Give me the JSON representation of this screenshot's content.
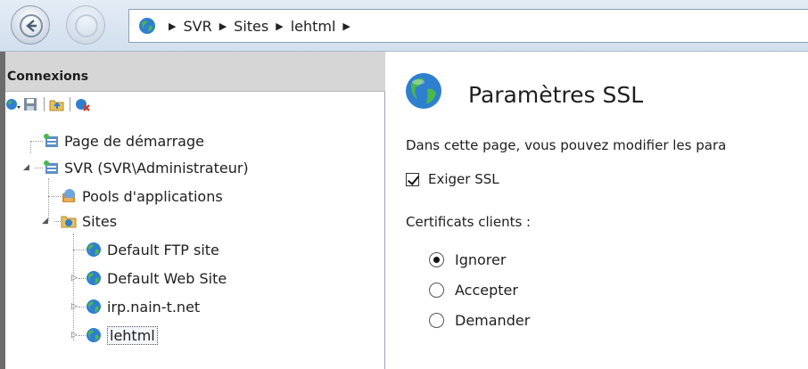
{
  "address_bar": {
    "breadcrumbs": [
      "SVR",
      "Sites",
      "lehtml"
    ]
  },
  "connections": {
    "header": "Connexions",
    "tree": {
      "start_page": "Page de démarrage",
      "server": "SVR (SVR\\Administrateur)",
      "app_pools": "Pools d'applications",
      "sites": "Sites",
      "site_items": [
        "Default FTP site",
        "Default Web Site",
        "irp.nain-t.net",
        "lehtml"
      ]
    }
  },
  "main": {
    "title": "Paramètres SSL",
    "description": "Dans cette page, vous pouvez modifier les para",
    "require_ssl_label": "Exiger SSL",
    "require_ssl_checked": true,
    "client_certs_label": "Certificats clients :",
    "client_cert_options": [
      "Ignorer",
      "Accepter",
      "Demander"
    ],
    "client_cert_selected": "Ignorer"
  }
}
